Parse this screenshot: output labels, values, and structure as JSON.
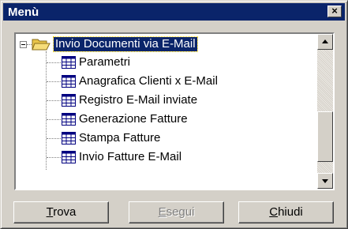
{
  "window": {
    "title": "Menù",
    "close_glyph": "×"
  },
  "tree": {
    "root": {
      "label": "Invio Documenti via E-Mail",
      "icon": "open-folder-icon",
      "expanded": true,
      "selected": true
    },
    "items": [
      {
        "label": "Parametri",
        "icon": "table-icon"
      },
      {
        "label": "Anagrafica Clienti x E-Mail",
        "icon": "table-icon"
      },
      {
        "label": "Registro E-Mail inviate",
        "icon": "table-icon"
      },
      {
        "label": "Generazione Fatture",
        "icon": "table-icon"
      },
      {
        "label": "Stampa Fatture",
        "icon": "table-icon"
      },
      {
        "label": "Invio Fatture E-Mail",
        "icon": "table-icon"
      }
    ]
  },
  "scrollbar": {
    "position_fraction": 0.85
  },
  "buttons": {
    "trova": {
      "accel": "T",
      "rest": "rova",
      "enabled": true
    },
    "esegui": {
      "accel": "E",
      "rest": "segui",
      "enabled": false
    },
    "chiudi": {
      "accel": "C",
      "rest": "hiudi",
      "enabled": true
    }
  },
  "colors": {
    "titlebar": "#0a246a",
    "face": "#d4d0c8",
    "selection": "#0a246a"
  }
}
